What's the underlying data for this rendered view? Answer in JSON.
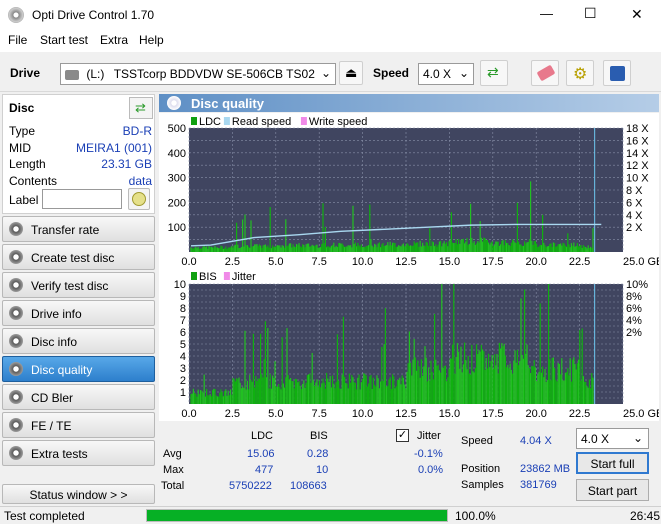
{
  "window": {
    "title": "Opti Drive Control 1.70",
    "minimize": "—",
    "maximize": "☐",
    "close": "✕"
  },
  "menu": [
    "File",
    "Start test",
    "Extra",
    "Help"
  ],
  "toolbar": {
    "drive_label": "Drive",
    "drive_letter": "(L:)",
    "drive_name": "TSSTcorp BDDVDW SE-506CB TS02",
    "speed_label": "Speed",
    "speed_value": "4.0 X"
  },
  "disc": {
    "header": "Disc",
    "fields": [
      {
        "k": "Type",
        "v": "BD-R"
      },
      {
        "k": "MID",
        "v": "MEIRA1 (001)"
      },
      {
        "k": "Length",
        "v": "23.31 GB"
      },
      {
        "k": "Contents",
        "v": "data"
      }
    ],
    "label_key": "Label",
    "label_value": ""
  },
  "nav": [
    "Transfer rate",
    "Create test disc",
    "Verify test disc",
    "Drive info",
    "Disc info",
    "Disc quality",
    "CD Bler",
    "FE / TE",
    "Extra tests"
  ],
  "nav_active": "Disc quality",
  "status_window": "Status window > >",
  "panel": {
    "title": "Disc quality"
  },
  "chart_data": [
    {
      "type": "bar",
      "title": "",
      "legend": [
        "LDC",
        "Read speed",
        "Write speed"
      ],
      "x": [
        0,
        2.5,
        5,
        7.5,
        10,
        12.5,
        15,
        17.5,
        20,
        22.5
      ],
      "xlim": [
        0,
        25
      ],
      "ylim": [
        0,
        500
      ],
      "y_ticks": [
        "500",
        "400",
        "300",
        "200",
        "100"
      ],
      "y2_ticks": [
        "18 X",
        "16 X",
        "14 X",
        "12 X",
        "10 X",
        "8 X",
        "6 X",
        "4 X",
        "2 X"
      ],
      "x_ticks": [
        "0.0",
        "2.5",
        "5.0",
        "7.5",
        "10.0",
        "12.5",
        "15.0",
        "17.5",
        "20.0",
        "22.5",
        "25.0 GB"
      ],
      "ldc_typical": [
        20,
        25,
        28,
        30,
        32,
        35,
        45,
        40,
        30,
        22
      ],
      "read_speed_x": [
        1.0,
        2.1,
        2.5,
        3.0,
        3.3,
        3.6,
        3.9,
        4.0,
        4.0,
        4.0
      ]
    },
    {
      "type": "bar",
      "title": "",
      "legend": [
        "BIS",
        "Jitter"
      ],
      "xlim": [
        0,
        25
      ],
      "ylim": [
        0,
        10
      ],
      "y_ticks": [
        "10",
        "9",
        "8",
        "7",
        "6",
        "5",
        "4",
        "3",
        "2",
        "1"
      ],
      "y2_ticks": [
        "10%",
        "8%",
        "6%",
        "4%",
        "2%"
      ],
      "x_ticks": [
        "0.0",
        "2.5",
        "5.0",
        "7.5",
        "10.0",
        "12.5",
        "15.0",
        "17.5",
        "20.0",
        "22.5",
        "25.0 GB"
      ],
      "bis_typical": [
        1,
        2,
        2,
        2,
        2,
        3,
        4,
        4,
        3,
        2
      ]
    }
  ],
  "stats": {
    "col_ldc": "LDC",
    "col_bis": "BIS",
    "jitter_label": "Jitter",
    "jitter_checked": "✓",
    "rows": [
      {
        "k": "Avg",
        "ldc": "15.06",
        "bis": "0.28",
        "jit": "-0.1%"
      },
      {
        "k": "Max",
        "ldc": "477",
        "bis": "10",
        "jit": "0.0%"
      },
      {
        "k": "Total",
        "ldc": "5750222",
        "bis": "108663",
        "jit": ""
      }
    ],
    "speed_k": "Speed",
    "speed_v": "4.04 X",
    "position_k": "Position",
    "position_v": "23862 MB",
    "samples_k": "Samples",
    "samples_v": "381769",
    "speed_select": "4.0 X",
    "start_full": "Start full",
    "start_part": "Start part"
  },
  "status": {
    "text": "Test completed",
    "progress": "100.0%",
    "progress_frac": 1.0,
    "time": "26:45"
  }
}
